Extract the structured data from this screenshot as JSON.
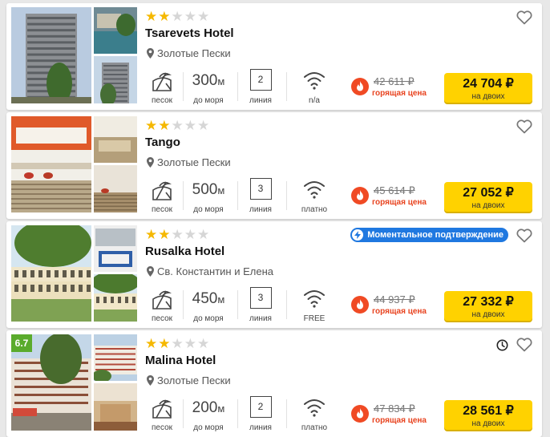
{
  "colors": {
    "accent_yellow": "#ffd200",
    "hot_red": "#e8431f",
    "badge_blue": "#1f78e0",
    "rating_green": "#5aab2c",
    "star_gold": "#f5b800"
  },
  "hotels": [
    {
      "stars": 2,
      "max_stars": 5,
      "name": "Tsarevets Hotel",
      "location": "Золотые Пески",
      "beach_label": "песок",
      "distance_value": "300",
      "distance_unit": "м",
      "distance_label": "до моря",
      "line_value": "2",
      "line_label": "линия",
      "wifi_label": "n/a",
      "old_price": "42 611 ₽",
      "hot_label": "горящая цена",
      "price": "24 704 ₽",
      "price_sub": "на двоих"
    },
    {
      "stars": 2,
      "max_stars": 5,
      "name": "Tango",
      "location": "Золотые Пески",
      "beach_label": "песок",
      "distance_value": "500",
      "distance_unit": "м",
      "distance_label": "до моря",
      "line_value": "3",
      "line_label": "линия",
      "wifi_label": "платно",
      "old_price": "45 614 ₽",
      "hot_label": "горящая цена",
      "price": "27 052 ₽",
      "price_sub": "на двоих"
    },
    {
      "stars": 2,
      "max_stars": 5,
      "name": "Rusalka Hotel",
      "location": "Св. Константин и Елена",
      "badge": "Моментальное подтверждение",
      "beach_label": "песок",
      "distance_value": "450",
      "distance_unit": "м",
      "distance_label": "до моря",
      "line_value": "3",
      "line_label": "линия",
      "wifi_label": "FREE",
      "old_price": "44 937 ₽",
      "hot_label": "горящая цена",
      "price": "27 332 ₽",
      "price_sub": "на двоих"
    },
    {
      "stars": 2,
      "max_stars": 5,
      "rating": "6.7",
      "name": "Malina Hotel",
      "location": "Золотые Пески",
      "beach_label": "песок",
      "distance_value": "200",
      "distance_unit": "м",
      "distance_label": "до моря",
      "line_value": "2",
      "line_label": "линия",
      "wifi_label": "платно",
      "old_price": "47 834 ₽",
      "hot_label": "горящая цена",
      "price": "28 561 ₽",
      "price_sub": "на двоих"
    }
  ],
  "icons": [
    "star-icon",
    "location-pin-icon",
    "beach-icon",
    "wifi-icon",
    "fire-icon",
    "heart-icon",
    "clock-icon",
    "lightning-icon"
  ]
}
